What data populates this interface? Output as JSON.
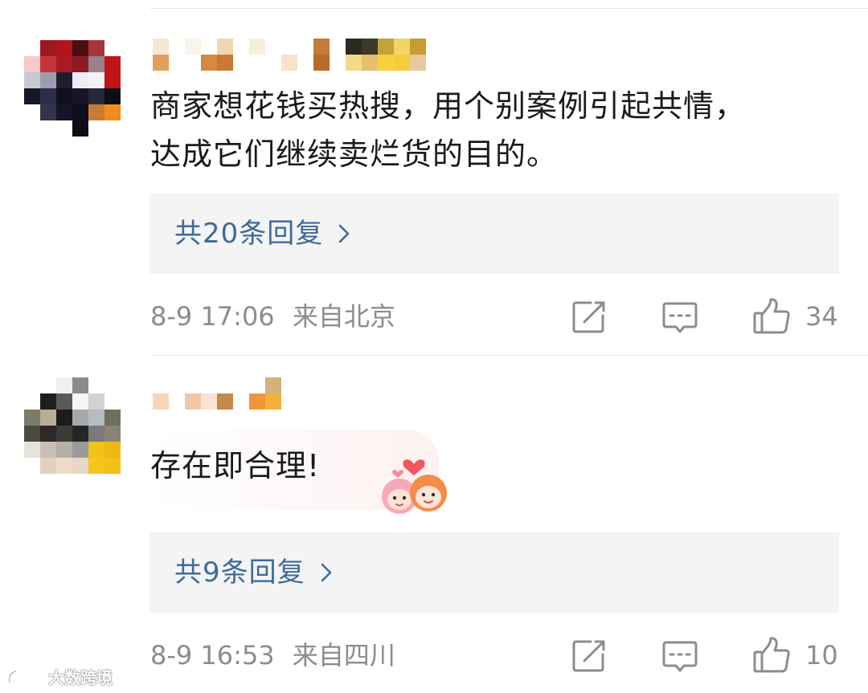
{
  "comments": [
    {
      "text_line1": "商家想花钱买热搜，用个别案例引起共情，",
      "text_line2": "达成它们继续卖烂货的目的。",
      "replies_label": "共20条回复",
      "timestamp": "8-9 17:06",
      "location": "来自北京",
      "like_count": "34"
    },
    {
      "text_line1": "存在即合理!",
      "replies_label": "共9条回复",
      "timestamp": "8-9 16:53",
      "location": "来自四川",
      "like_count": "10"
    }
  ],
  "icons": {
    "share": "share-icon",
    "comment": "comment-icon",
    "like": "thumbs-up-icon",
    "reply_arrow": "chevron-right-icon"
  },
  "colors": {
    "reply_link": "#3e6a9a",
    "meta_text": "#8c8c8c",
    "reply_box_bg": "#f4f4f4"
  },
  "watermark": {
    "text": "大数跨境"
  }
}
